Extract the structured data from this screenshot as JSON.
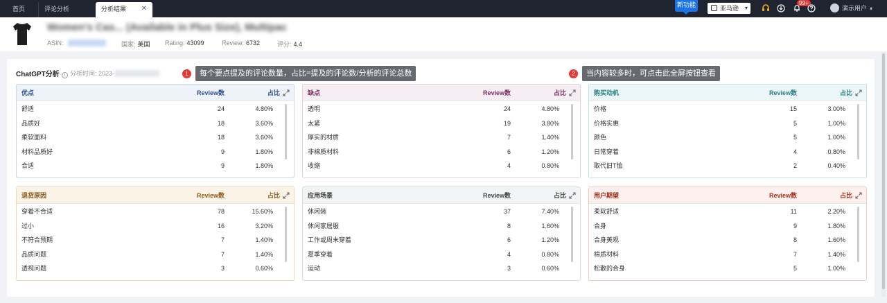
{
  "topbar": {
    "tabs": [
      {
        "label": "首页"
      },
      {
        "label": "评论分析"
      },
      {
        "label": "分析结果"
      }
    ],
    "new_feature": "新功能",
    "marketplace": "亚马逊",
    "notification_badge": "99+",
    "user": "演示用户"
  },
  "product": {
    "title": "Women's Cas... (Available in Plus Size), Multipac",
    "asin_label": "ASIN:",
    "country_label": "国家:",
    "country": "美国",
    "rating_label": "Rating:",
    "rating": "43099",
    "review_label": "Review:",
    "review": "6732",
    "score_label": "评分:",
    "score": "4.4"
  },
  "analysis": {
    "title": "ChatGPT分析",
    "time_label": "分析时间: 2023-"
  },
  "tips": [
    {
      "num": "1",
      "text": "每个要点提及的评论数量，占比=提及的评论数/分析的评论总数"
    },
    {
      "num": "2",
      "text": "当内容较多时，可点击此全屏按钮查看"
    }
  ],
  "col_review": "Review数",
  "col_pct": "占比",
  "cards": [
    {
      "name": "优点",
      "color": "#2f4f8f",
      "rows": [
        {
          "label": "舒适",
          "count": "24",
          "pct": "4.80%"
        },
        {
          "label": "品质好",
          "count": "18",
          "pct": "3.60%"
        },
        {
          "label": "柔软面料",
          "count": "18",
          "pct": "3.60%"
        },
        {
          "label": "材料品质好",
          "count": "9",
          "pct": "1.80%"
        },
        {
          "label": "合适",
          "count": "9",
          "pct": "1.80%"
        }
      ]
    },
    {
      "name": "缺点",
      "color": "#7a2f63",
      "rows": [
        {
          "label": "透明",
          "count": "24",
          "pct": "4.80%"
        },
        {
          "label": "太紧",
          "count": "19",
          "pct": "3.80%"
        },
        {
          "label": "厚实的材质",
          "count": "7",
          "pct": "1.40%"
        },
        {
          "label": "非棉质材料",
          "count": "6",
          "pct": "1.20%"
        },
        {
          "label": "收缩",
          "count": "4",
          "pct": "0.80%"
        }
      ]
    },
    {
      "name": "购买动机",
      "color": "#2a7f86",
      "rows": [
        {
          "label": "价格",
          "count": "15",
          "pct": "3.00%"
        },
        {
          "label": "价格实惠",
          "count": "5",
          "pct": "1.00%"
        },
        {
          "label": "颜色",
          "count": "5",
          "pct": "1.00%"
        },
        {
          "label": "日常穿着",
          "count": "4",
          "pct": "0.80%"
        },
        {
          "label": "取代旧T恤",
          "count": "2",
          "pct": "0.40%"
        }
      ]
    },
    {
      "name": "退货原因",
      "color": "#8a5a1f",
      "rows": [
        {
          "label": "穿着不合适",
          "count": "78",
          "pct": "15.60%"
        },
        {
          "label": "过小",
          "count": "16",
          "pct": "3.20%"
        },
        {
          "label": "不符合预期",
          "count": "7",
          "pct": "1.40%"
        },
        {
          "label": "品质问题",
          "count": "7",
          "pct": "1.40%"
        },
        {
          "label": "透视问题",
          "count": "3",
          "pct": "0.60%"
        }
      ]
    },
    {
      "name": "应用场景",
      "color": "#444444",
      "rows": [
        {
          "label": "休闲装",
          "count": "37",
          "pct": "7.40%"
        },
        {
          "label": "休闲家居服",
          "count": "8",
          "pct": "1.60%"
        },
        {
          "label": "工作或周末穿着",
          "count": "6",
          "pct": "1.20%"
        },
        {
          "label": "夏季穿着",
          "count": "4",
          "pct": "0.80%"
        },
        {
          "label": "运动",
          "count": "3",
          "pct": "0.60%"
        }
      ]
    },
    {
      "name": "用户期望",
      "color": "#a8321f",
      "rows": [
        {
          "label": "柔软舒适",
          "count": "11",
          "pct": "2.20%"
        },
        {
          "label": "合身",
          "count": "9",
          "pct": "1.80%"
        },
        {
          "label": "合身美观",
          "count": "8",
          "pct": "1.60%"
        },
        {
          "label": "棉质材料",
          "count": "7",
          "pct": "1.40%"
        },
        {
          "label": "松散的合身",
          "count": "5",
          "pct": "1.00%"
        }
      ]
    }
  ]
}
